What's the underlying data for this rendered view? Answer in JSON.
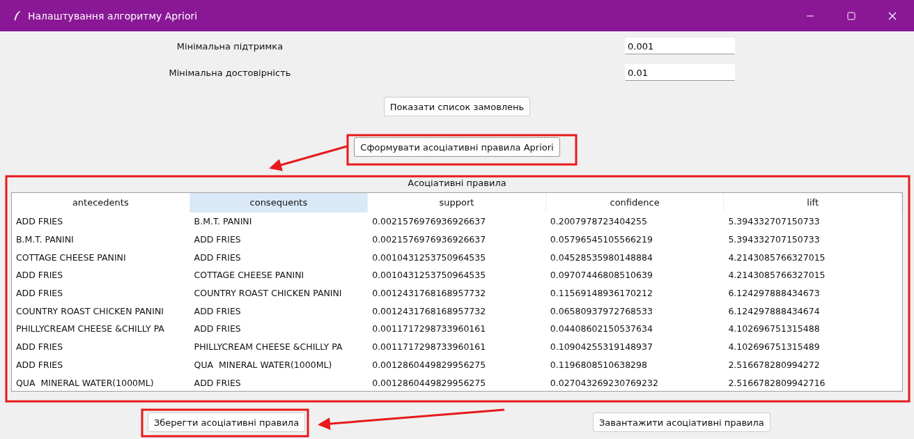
{
  "window": {
    "title": "Налаштування алгоритму Apriori"
  },
  "fields": [
    {
      "label": "Мінімальна підтримка",
      "value": "0.001"
    },
    {
      "label": "Мінімальна достовірність",
      "value": "0.01"
    }
  ],
  "show_orders_button": "Показати список замовлень",
  "generate_button": "Сформувати асоціативні правила Apriori",
  "table": {
    "title": "Асоціативні правила",
    "columns": [
      {
        "label": "antecedents",
        "selected": false
      },
      {
        "label": "consequents",
        "selected": true
      },
      {
        "label": "support",
        "selected": false
      },
      {
        "label": "confidence",
        "selected": false
      },
      {
        "label": "lift",
        "selected": false
      }
    ],
    "rows": [
      [
        "ADD FRIES",
        "B.M.T. PANINI",
        "0.0021576976936926637",
        "0.2007978723404255",
        "5.394332707150733"
      ],
      [
        "B.M.T. PANINI",
        "ADD FRIES",
        "0.0021576976936926637",
        "0.05796545105566219",
        "5.394332707150733"
      ],
      [
        "COTTAGE CHEESE PANINI",
        "ADD FRIES",
        "0.0010431253750964535",
        "0.04528535980148884",
        "4.2143085766327015"
      ],
      [
        "ADD FRIES",
        "COTTAGE CHEESE PANINI",
        "0.0010431253750964535",
        "0.09707446808510639",
        "4.2143085766327015"
      ],
      [
        "ADD FRIES",
        "COUNTRY ROAST CHICKEN PANINI",
        "0.0012431768168957732",
        "0.11569148936170212",
        "6.124297888434673"
      ],
      [
        "COUNTRY ROAST CHICKEN PANINI",
        "ADD FRIES",
        "0.0012431768168957732",
        "0.06580937972768533",
        "6.124297888434674"
      ],
      [
        "PHILLYCREAM CHEESE &CHILLY PA",
        "ADD FRIES",
        "0.0011717298733960161",
        "0.04408602150537634",
        "4.102696751315488"
      ],
      [
        "ADD FRIES",
        "PHILLYCREAM CHEESE &CHILLY PA",
        "0.0011717298733960161",
        "0.10904255319148937",
        "4.102696751315489"
      ],
      [
        "ADD FRIES",
        "QUA  MINERAL WATER(1000ML)",
        "0.0012860449829956275",
        "0.1196808510638298",
        "2.516678280994272"
      ],
      [
        "QUA  MINERAL WATER(1000ML)",
        "ADD FRIES",
        "0.0012860449829956275",
        "0.027043269230769232",
        "2.5166782809942716"
      ]
    ]
  },
  "save_button": "Зберегти асоціативні правила",
  "load_button": "Завантажити асоціативні правила"
}
